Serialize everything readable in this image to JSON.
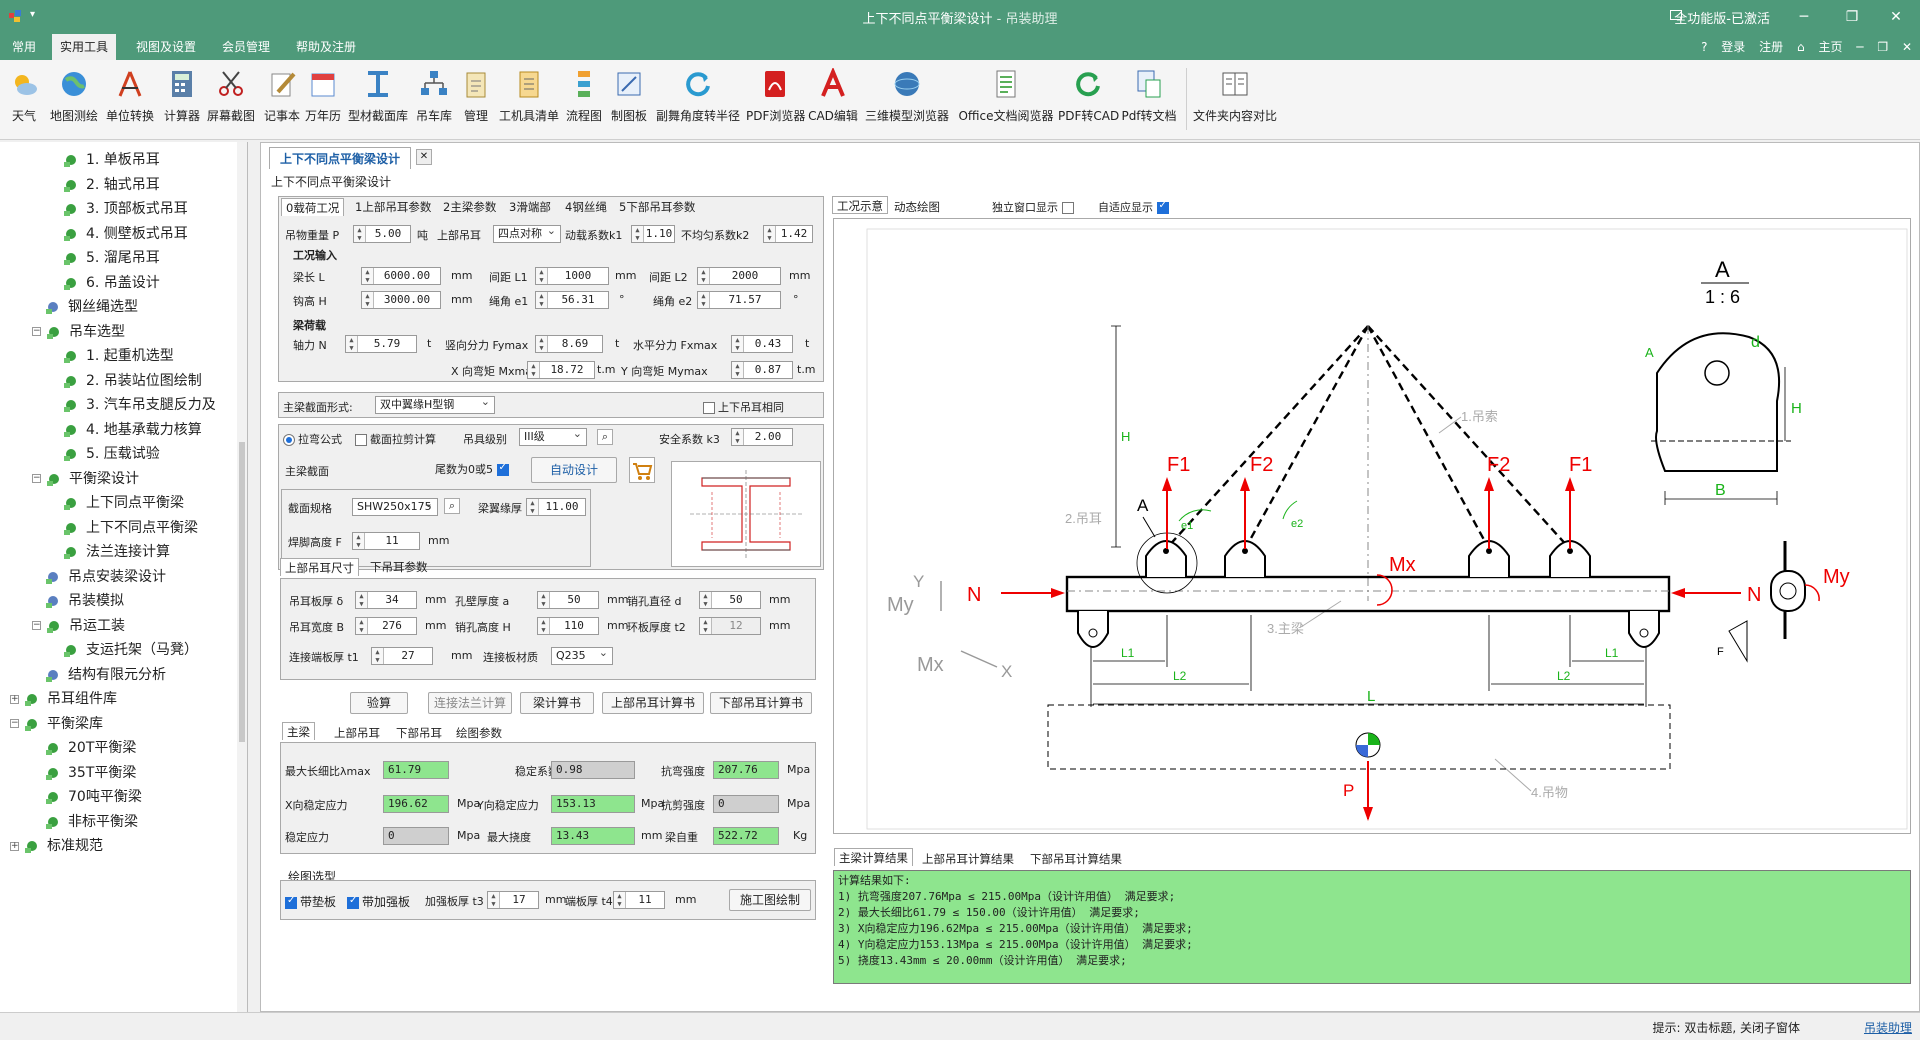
{
  "titlebar": {
    "title": "上下不同点平衡梁设计",
    "subtitle": " - 吊装助理",
    "edition": "全功能版-已激活"
  },
  "menubar": {
    "items": [
      "常用",
      "实用工具",
      "视图及设置",
      "会员管理",
      "帮助及注册"
    ],
    "right": [
      "登录",
      "注册",
      "主页"
    ]
  },
  "toolbar": {
    "items": [
      "天气",
      "地图测绘",
      "单位转换",
      "计算器",
      "屏幕截图",
      "记事本",
      "万年历",
      "型材截面库",
      "吊车库",
      "管理",
      "工机具清单",
      "流程图",
      "制图板",
      "副舞角度转半径",
      "PDF浏览器",
      "CAD编辑",
      "三维模型浏览器",
      "Office文档阅览器",
      "PDF转CAD",
      "Pdf转文档",
      "文件夹内容对比"
    ]
  },
  "tree": {
    "items": [
      "1. 单板吊耳",
      "2. 轴式吊耳",
      "3. 顶部板式吊耳",
      "4. 侧壁板式吊耳",
      "5. 溜尾吊耳",
      "6. 吊盖设计",
      "钢丝绳选型",
      "吊车选型",
      "1. 起重机选型",
      "2. 吊装站位图绘制",
      "3. 汽车吊支腿反力及",
      "4. 地基承载力核算",
      "5. 压载试验",
      "平衡梁设计",
      "上下同点平衡梁",
      "上下不同点平衡梁",
      "法兰连接计算",
      "吊点安装梁设计",
      "吊装模拟",
      "吊运工装",
      "支运托架（马凳）",
      "结构有限元分析",
      "吊耳组件库",
      "平衡梁库",
      "20T平衡梁",
      "35T平衡梁",
      "70吨平衡梁",
      "非标平衡梁",
      "标准规范"
    ]
  },
  "doc": {
    "tab": "上下不同点平衡梁设计",
    "group_title": "上下不同点平衡梁设计"
  },
  "load_tabs": [
    "0载荷工况",
    "1上部吊耳参数",
    "2主梁参数",
    "3滑端部",
    "4钢丝绳",
    "5下部吊耳参数"
  ],
  "load": {
    "weight_label": "吊物重量 P",
    "weight": "5.00",
    "weight_unit": "吨",
    "upper_ear_label": "上部吊耳",
    "upper_ear_value": "四点对称",
    "dyn_label": "动载系数k1",
    "dyn_value": "1.10",
    "uneven_label": "不均匀系数k2",
    "uneven_value": "1.42",
    "case_title": "工况输入",
    "beam_len_label": "梁长 L",
    "beam_len": "6000.00",
    "spacing1_label": "间距 L1",
    "spacing1": "1000",
    "spacing2_label": "间距 L2",
    "spacing2": "2000",
    "hook_label": "钩高 H",
    "hook": "3000.00",
    "angle1_label": "绳角 e1",
    "angle1": "56.31",
    "angle2_label": "绳角 e2",
    "angle2": "71.57",
    "unit_mm": "mm",
    "unit_deg": "°",
    "beam_load_title": "梁荷载",
    "axial_label": "轴力 N",
    "axial": "5.79",
    "vert_label": "竖向分力 Fymax",
    "vert": "8.69",
    "horiz_label": "水平分力 Fxmax",
    "horiz": "0.43",
    "unit_t": "t",
    "mx_label": "X 向弯矩 Mxmax",
    "mx": "18.72",
    "my_label": "Y 向弯矩 Mymax",
    "my": "0.87",
    "unit_tm": "t.m"
  },
  "section": {
    "form_label": "主梁截面形式:",
    "form_value": "双中翼缘H型钢",
    "same_label": "上下吊耳相同",
    "method1": "拉弯公式",
    "method2": "截面拉剪计算",
    "grade_label": "吊具级别",
    "grade_value": "III级",
    "safety_label": "安全系数 k3",
    "safety_value": "2.00",
    "main_label": "主梁截面",
    "tail_label": "尾数为0或5",
    "auto_btn": "自动设计",
    "spec_label": "截面规格",
    "spec_value": "SHW250x175",
    "flange_label": "梁翼缘厚 δ",
    "flange_value": "11.00",
    "weld_label": "焊脚高度 F",
    "weld_value": "11",
    "unit_mm": "mm"
  },
  "ear": {
    "tabs": [
      "上部吊耳尺寸",
      "下吊耳参数"
    ],
    "thick_label": "吊耳板厚 δ",
    "thick": "34",
    "hole_wall_label": "孔壁厚度 a",
    "hole_wall": "50",
    "pin_label": "销孔直径 d",
    "pin": "50",
    "width_label": "吊耳宽度 B",
    "width": "276",
    "pin_h_label": "销孔高度 H",
    "pin_h": "110",
    "ring_label": "环板厚度 t2",
    "ring": "12",
    "end_label": "连接端板厚 t1",
    "end": "27",
    "mat_label": "连接板材质",
    "mat": "Q235",
    "unit_mm": "mm"
  },
  "buttons": [
    "验算",
    "连接法兰计算",
    "梁计算书",
    "上部吊耳计算书",
    "下部吊耳计算书"
  ],
  "result_tabs": [
    "主梁",
    "上部吊耳",
    "下部吊耳",
    "绘图参数"
  ],
  "results": {
    "slender_label": "最大长细比λmax",
    "slender": "61.79",
    "stab_coef_label": "稳定系数Φ",
    "stab_coef": "0.98",
    "bend_label": "抗弯强度",
    "bend": "207.76",
    "x_stab_label": "X向稳定应力",
    "x_stab": "196.62",
    "y_stab_label": "Y向稳定应力",
    "y_stab": "153.13",
    "shear_label": "抗剪强度",
    "shear": "0",
    "stab_label": "稳定应力",
    "stab": "0",
    "defl_label": "最大挠度",
    "defl": "13.43",
    "self_label": "梁自重",
    "self": "522.72",
    "unit_mpa": "Mpa",
    "unit_mm": "mm",
    "unit_kg": "Kg"
  },
  "drawing": {
    "title": "绘图选型",
    "pad_label": "带垫板",
    "stiff_label": "带加强板",
    "stiff_t_label": "加强板厚 t3",
    "stiff_t": "17",
    "end_t_label": "端板厚 t4",
    "end_t": "11",
    "unit_mm": "mm",
    "btn": "施工图绘制"
  },
  "view": {
    "tabs": [
      "工况示意",
      "动态绘图"
    ],
    "independent": "独立窗口显示",
    "adaptive": "自适应显示"
  },
  "diagram": {
    "f1": "F1",
    "f2": "F2",
    "n": "N",
    "mx": "Mx",
    "my": "My",
    "p": "P",
    "a": "A",
    "h": "H",
    "l": "L",
    "l1": "L1",
    "l2": "L2",
    "f": "F",
    "e1": "e1",
    "e2": "e2",
    "x": "X",
    "y": "Y",
    "d": "d",
    "b": "B",
    "scale_a": "A",
    "scale": "1 : 6",
    "lbl_rope": "1.吊索",
    "lbl_ear": "2.吊耳",
    "lbl_beam": "3.主梁",
    "lbl_load": "4.吊物"
  },
  "output_tabs": [
    "主梁计算结果",
    "上部吊耳计算结果",
    "下部吊耳计算结果"
  ],
  "output": {
    "lines": [
      "计算结果如下:",
      "    1) 抗弯强度207.76Mpa ≤ 215.00Mpa（设计许用值） 满足要求;",
      "    2) 最大长细比61.79 ≤ 150.00（设计许用值） 满足要求;",
      "    3) X向稳定应力196.62Mpa ≤ 215.00Mpa（设计许用值） 满足要求;",
      "    4) Y向稳定应力153.13Mpa ≤ 215.00Mpa（设计许用值） 满足要求;",
      "    5) 挠度13.43mm ≤ 20.00mm（设计许用值） 满足要求;"
    ]
  },
  "status": {
    "hint": "提示: 双击标题, 关闭子窗体",
    "link": "吊装助理"
  }
}
